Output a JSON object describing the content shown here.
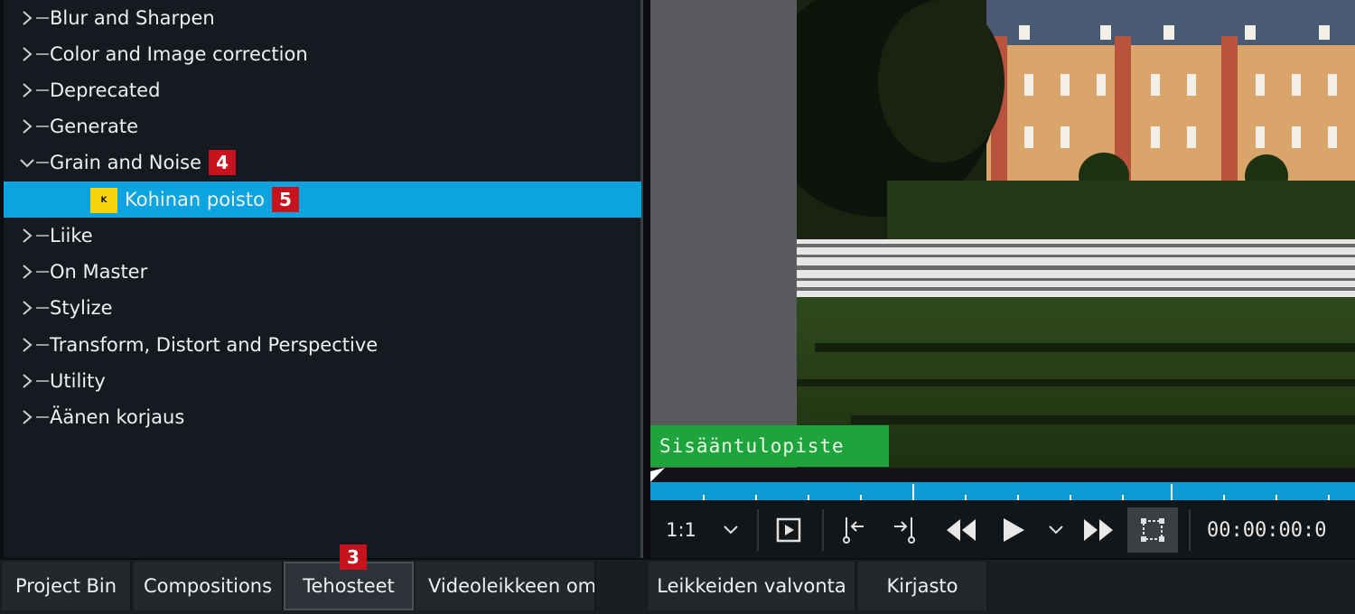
{
  "effects_tree": {
    "categories": [
      {
        "label": "Blur and Sharpen",
        "expanded": false
      },
      {
        "label": "Color and Image correction",
        "expanded": false
      },
      {
        "label": "Deprecated",
        "expanded": false
      },
      {
        "label": "Generate",
        "expanded": false
      },
      {
        "label": "Grain and Noise",
        "expanded": true,
        "badge": "4"
      },
      {
        "label": "Liike",
        "expanded": false
      },
      {
        "label": "On Master",
        "expanded": false
      },
      {
        "label": "Stylize",
        "expanded": false
      },
      {
        "label": "Transform, Distort and Perspective",
        "expanded": false
      },
      {
        "label": "Utility",
        "expanded": false
      },
      {
        "label": "Äänen korjaus",
        "expanded": false
      }
    ],
    "selected_child": {
      "label": "Kohinan poisto",
      "icon_letter": "K",
      "badge": "5"
    }
  },
  "monitor": {
    "inpoint_label": "Sisääntulopiste",
    "zoom": "1:1",
    "timecode": "00:00:00:0"
  },
  "tabs": {
    "items": [
      {
        "label": "Project Bin"
      },
      {
        "label": "Compositions"
      },
      {
        "label": "Tehosteet"
      },
      {
        "label": "Videoleikkeen om"
      },
      {
        "label": "Leikkeiden valvonta"
      },
      {
        "label": "Kirjasto"
      }
    ],
    "active_badge": "3"
  },
  "colors": {
    "selection": "#0aa5e0",
    "badge_red": "#c8121d",
    "inpoint_green": "#1fa33d",
    "ruler_blue": "#0e9ad2",
    "effect_icon_yellow": "#f6d40b"
  },
  "icons": {
    "collapsed": "chevron-right-icon",
    "expanded": "chevron-down-icon",
    "zoom_dropdown": "chevron-down-icon",
    "monitor_toggle": "play-in-frame-icon",
    "set_in": "set-in-point-icon",
    "set_out": "set-out-point-icon",
    "rewind": "rewind-icon",
    "play": "play-icon",
    "play_options": "chevron-down-icon",
    "forward": "fast-forward-icon",
    "edit_mode": "transform-frame-icon"
  }
}
